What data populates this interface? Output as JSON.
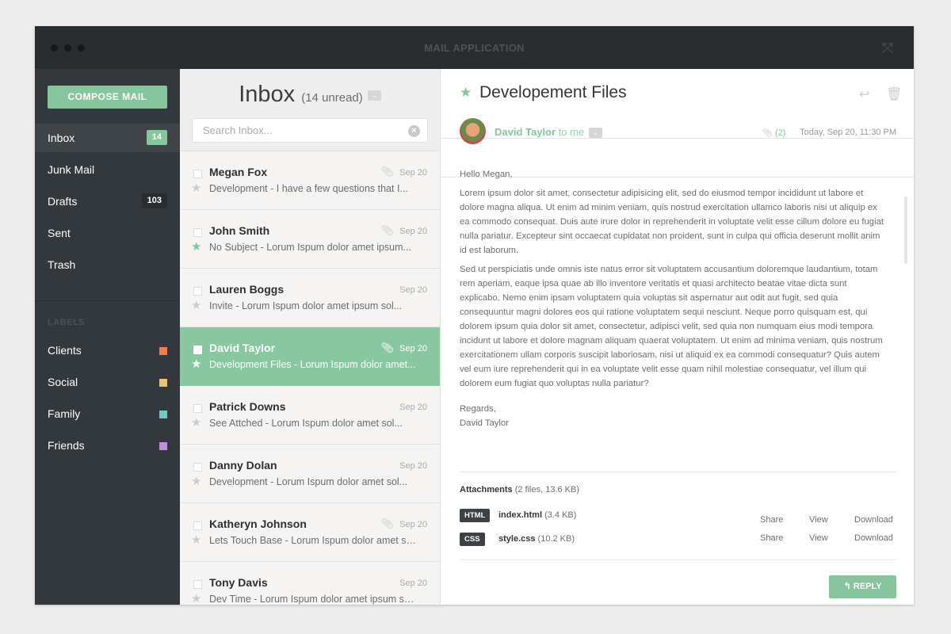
{
  "window": {
    "title": "MAIL APPLICATION"
  },
  "sidebar": {
    "compose_label": "COMPOSE MAIL",
    "folders": [
      {
        "label": "Inbox",
        "badge": "14",
        "badge_color": "#86c59d",
        "active": true
      },
      {
        "label": "Junk Mail"
      },
      {
        "label": "Drafts",
        "badge": "103",
        "badge_color": "#292d30"
      },
      {
        "label": "Sent"
      },
      {
        "label": "Trash"
      }
    ],
    "labels_heading": "LABELS",
    "labels": [
      {
        "label": "Clients",
        "color": "#f47b4a"
      },
      {
        "label": "Social",
        "color": "#e6c46f"
      },
      {
        "label": "Family",
        "color": "#6fcbc3"
      },
      {
        "label": "Friends",
        "color": "#c08fe0"
      }
    ]
  },
  "list": {
    "title": "Inbox",
    "unread": "(14 unread)",
    "search_placeholder": "Search Inbox...",
    "messages": [
      {
        "name": "Megan Fox",
        "snippet": "Development - I have a few questions that I...",
        "date": "Sep 20",
        "attachment": true,
        "starred": false
      },
      {
        "name": "John Smith",
        "snippet": "No Subject - Lorum Ispum dolor amet ipsum...",
        "date": "Sep 20",
        "attachment": true,
        "starred": true
      },
      {
        "name": "Lauren Boggs",
        "snippet": "Invite - Lorum Ispum dolor amet ipsum sol...",
        "date": "Sep 20",
        "attachment": false,
        "starred": false
      },
      {
        "name": "David Taylor",
        "snippet": "Development Files - Lorum Ispum dolor amet...",
        "date": "Sep 20",
        "attachment": true,
        "starred": true,
        "selected": true
      },
      {
        "name": "Patrick Downs",
        "snippet": "See Attched - Lorum Ispum dolor amet sol...",
        "date": "Sep 20",
        "attachment": false,
        "starred": false
      },
      {
        "name": "Danny Dolan",
        "snippet": "Development - Lorum Ispum dolor amet sol...",
        "date": "Sep 20",
        "attachment": false,
        "starred": false
      },
      {
        "name": "Katheryn Johnson",
        "snippet": "Lets Touch Base - Lorum Ispum dolor amet sol...",
        "date": "Sep 20",
        "attachment": true,
        "starred": false
      },
      {
        "name": "Tony Davis",
        "snippet": "Dev Time - Lorum Ispum dolor amet ipsum sol...",
        "date": "Sep 20",
        "attachment": false,
        "starred": false
      }
    ]
  },
  "detail": {
    "subject": "Developement Files",
    "sender": "David Taylor",
    "recipient": "to me",
    "attachment_count": "(2)",
    "time": "Today, Sep 20, 11:30 PM",
    "greeting": "Hello Megan,",
    "paragraphs": [
      "Lorem ipsum dolor sit amet, consectetur adipisicing elit, sed do eiusmod tempor incididunt ut labore et dolore magna aliqua. Ut enim ad minim veniam, quis nostrud exercitation ullamco laboris nisi ut aliquip ex ea commodo consequat. Duis aute irure dolor in reprehenderit in voluptate velit esse cillum dolore eu fugiat nulla pariatur. Excepteur sint occaecat cupidatat non proident, sunt in culpa qui officia deserunt mollit anim id est laborum.",
      "Sed ut perspiciatis unde omnis iste natus error sit voluptatem accusantium doloremque laudantium, totam rem aperiam, eaque ipsa quae ab illo inventore veritatis et quasi architecto beatae vitae dicta sunt explicabo. Nemo enim ipsam voluptatem quia voluptas sit aspernatur aut odit aut fugit, sed quia consequuntur magni dolores eos qui ratione voluptatem sequi nesciunt. Neque porro quisquam est, qui dolorem ipsum quia dolor sit amet, consectetur, adipisci velit, sed quia non numquam eius modi tempora incidunt ut labore et dolore magnam aliquam quaerat voluptatem. Ut enim ad minima veniam, quis nostrum exercitationem ullam corporis suscipit laboriosam, nisi ut aliquid ex ea commodi consequatur? Quis autem vel eum iure reprehenderit qui in ea voluptate velit esse quam nihil molestiae consequatur, vel illum qui dolorem eum fugiat quo voluptas nulla pariatur?"
    ],
    "signoff": "Regards,",
    "signature": "David Taylor",
    "attachments_label": "Attachments",
    "attachments_summary": "(2 files, 13.6 KB)",
    "attachments": [
      {
        "type": "HTML",
        "name": "index.html",
        "size": "(3.4 KB)"
      },
      {
        "type": "CSS",
        "name": "style.css",
        "size": "(10.2 KB)"
      }
    ],
    "actions": {
      "share": "Share",
      "view": "View",
      "download": "Download"
    },
    "reply_label": "REPLY"
  },
  "colors": {
    "accent": "#86c59d",
    "titlebar": "#292d30",
    "sidebar": "#33383c"
  }
}
